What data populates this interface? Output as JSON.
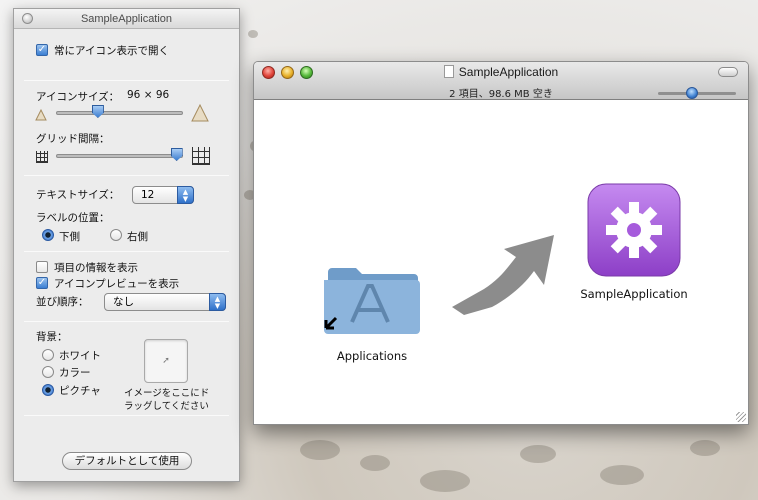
{
  "inspector": {
    "title": "SampleApplication",
    "always_open_icon_view": "常にアイコン表示で開く",
    "icon_size_label": "アイコンサイズ：",
    "icon_size_value": "96 × 96",
    "icon_size_level": 0.33,
    "grid_spacing_label": "グリッド間隔：",
    "grid_spacing_level": 0.95,
    "text_size_label": "テキストサイズ：",
    "text_size_value": "12",
    "label_position_label": "ラベルの位置：",
    "label_bottom": "下側",
    "label_right": "右側",
    "show_item_info": "項目の情報を表示",
    "show_icon_preview": "アイコンプレビューを表示",
    "sort_order_label": "並び順序：",
    "sort_order_value": "なし",
    "background_label": "背景：",
    "bg_white": "ホワイト",
    "bg_color": "カラー",
    "bg_picture": "ピクチャ",
    "drop_hint_line1": "イメージをここにド",
    "drop_hint_line2": "ラッグしてください",
    "use_as_defaults": "デフォルトとして使用"
  },
  "finder": {
    "title": "SampleApplication",
    "status": "2 項目、98.6 MB 空き",
    "items": [
      {
        "label": "Applications",
        "icon": "applications-folder-icon"
      },
      {
        "label": "SampleApplication",
        "icon": "gear-app-icon"
      }
    ],
    "app_icon_color": "#9b4fd1"
  },
  "colors": {
    "accent": "#3b7fd3",
    "folder_blue": "#7fa7cf",
    "arrow_gray": "#8c8c8c"
  }
}
